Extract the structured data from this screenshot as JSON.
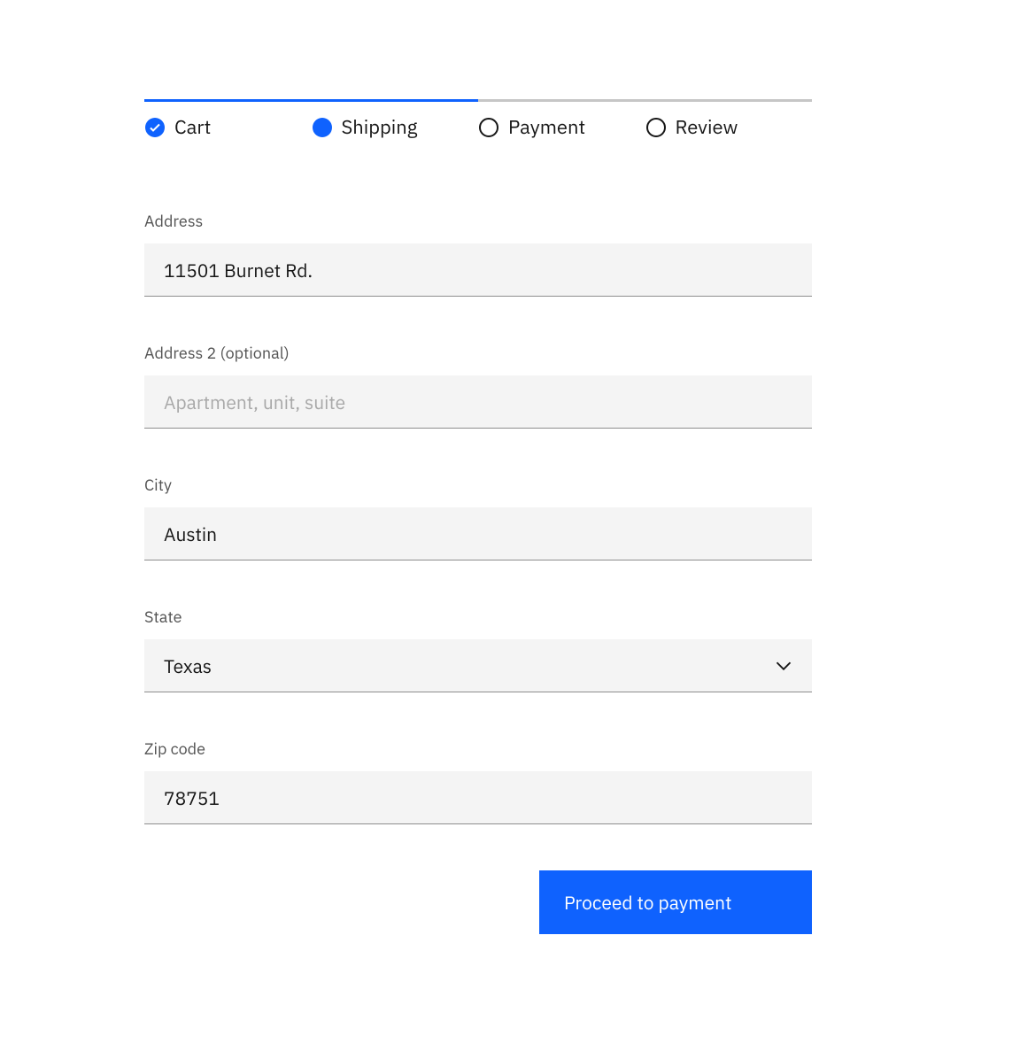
{
  "progress": {
    "steps": [
      {
        "label": "Cart",
        "state": "complete"
      },
      {
        "label": "Shipping",
        "state": "current"
      },
      {
        "label": "Payment",
        "state": "incomplete"
      },
      {
        "label": "Review",
        "state": "incomplete"
      }
    ]
  },
  "form": {
    "address": {
      "label": "Address",
      "value": "11501 Burnet Rd."
    },
    "address2": {
      "label": "Address 2 (optional)",
      "placeholder": "Apartment, unit, suite",
      "value": ""
    },
    "city": {
      "label": "City",
      "value": "Austin"
    },
    "state": {
      "label": "State",
      "value": "Texas"
    },
    "zip": {
      "label": "Zip code",
      "value": "78751"
    }
  },
  "button": {
    "proceed": "Proceed to payment"
  }
}
